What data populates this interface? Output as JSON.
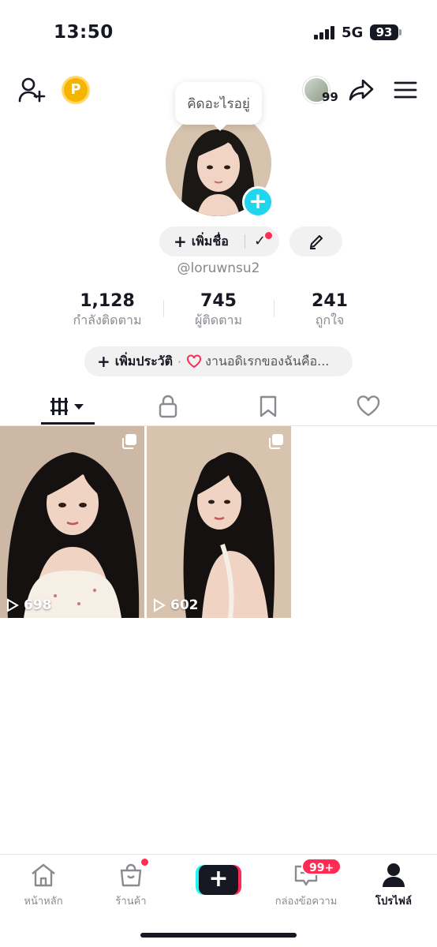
{
  "status_bar": {
    "time": "13:50",
    "network": "5G",
    "battery": "93"
  },
  "header": {
    "coin_letter": "P",
    "visitor_count": "99",
    "icons": [
      "add-friend-icon",
      "coin-icon",
      "visitor-avatar",
      "share-icon",
      "menu-icon"
    ]
  },
  "profile": {
    "bubble_text": "คิดอะไรอยู่",
    "add_name_plus": "+",
    "add_name_label": "เพิ่มชื่อ",
    "check_mark": "✓",
    "username": "@loruwnsu2",
    "add_avatar_plus": "+"
  },
  "stats": [
    {
      "value": "1,128",
      "label": "กำลังติดตาม"
    },
    {
      "value": "745",
      "label": "ผู้ติดตาม"
    },
    {
      "value": "241",
      "label": "ถูกใจ"
    }
  ],
  "bio": {
    "plus": "+",
    "add_label": "เพิ่มประวัติ",
    "separator": "·",
    "text": "งานอดิเรกของฉันคือ..."
  },
  "tabs": [
    "videos-grid-icon",
    "lock-icon",
    "bookmark-icon",
    "heart-icon"
  ],
  "videos": [
    {
      "views": "698"
    },
    {
      "views": "602"
    }
  ],
  "bottom_nav": {
    "home": "หน้าหลัก",
    "shop": "ร้านค้า",
    "create": "+",
    "inbox": "กล่องข้อความ",
    "inbox_badge": "99+",
    "profile": "โปรไฟล์"
  },
  "colors": {
    "accent_red": "#fe2c55",
    "accent_cyan": "#20d5ec",
    "coin": "#f5b400",
    "text": "#161823"
  }
}
